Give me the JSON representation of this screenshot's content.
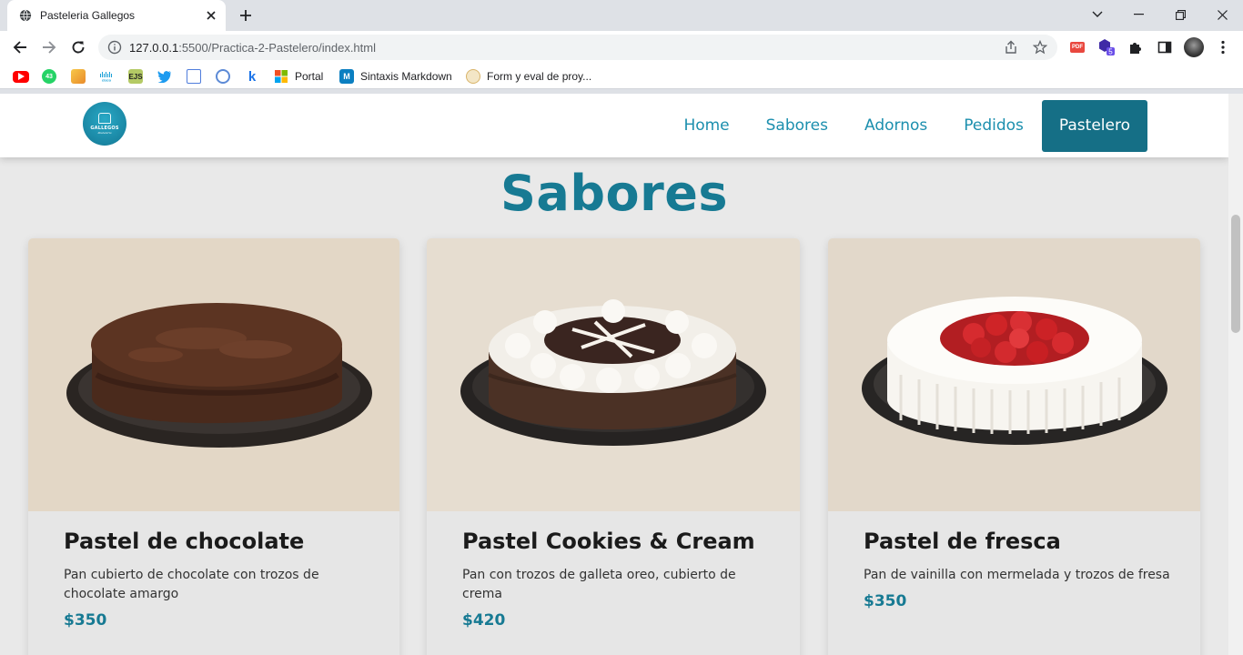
{
  "browser": {
    "tab_title": "Pasteleria Gallegos",
    "url_host": "127.0.0.1",
    "url_path": ":5500/Practica-2-Pastelero/index.html",
    "bookmarks": [
      {
        "label": "",
        "icon": "youtube-icon",
        "color": "#ff0000"
      },
      {
        "label": "",
        "icon": "whatsapp-icon",
        "color": "#25d366",
        "badge": "43"
      },
      {
        "label": "",
        "icon": "notes-icon",
        "color": "#f4a623"
      },
      {
        "label": "",
        "icon": "cisco-icon",
        "color": "#1ba0d7"
      },
      {
        "label": "",
        "icon": "ejs-icon",
        "color": "#b4ca65"
      },
      {
        "label": "",
        "icon": "twitter-icon",
        "color": "#1d9bf0"
      },
      {
        "label": "",
        "icon": "calendar-icon",
        "color": "#4f7ddc"
      },
      {
        "label": "",
        "icon": "target-icon",
        "color": "#5c8ad6"
      },
      {
        "label": "",
        "icon": "k-icon",
        "color": "#1a73e8"
      },
      {
        "label": "Portal",
        "icon": "microsoft-icon",
        "color": "#f25022"
      },
      {
        "label": "Sintaxis Markdown",
        "icon": "markdown-icon",
        "color": "#0b7fc1"
      },
      {
        "label": "Form y eval de proy...",
        "icon": "seal-icon",
        "color": "#d9b46a"
      }
    ],
    "extension_badge": "5"
  },
  "site": {
    "nav": {
      "home": "Home",
      "sabores": "Sabores",
      "adornos": "Adornos",
      "pedidos": "Pedidos",
      "pastelero": "Pastelero"
    },
    "logo_text": "GALLEGOS",
    "logo_sub": "Pasteleria",
    "section_title": "Sabores",
    "cards": [
      {
        "title": "Pastel de chocolate",
        "description": "Pan cubierto de chocolate con trozos de chocolate amargo",
        "price": "$350",
        "image": "chocolate-cake-image"
      },
      {
        "title": "Pastel Cookies & Cream",
        "description": "Pan con trozos de galleta oreo, cubierto de crema",
        "price": "$420",
        "image": "cookies-cream-cake-image"
      },
      {
        "title": "Pastel de fresca",
        "description": "Pan de vainilla con mermelada y trozos de fresa",
        "price": "$350",
        "image": "strawberry-cake-image"
      }
    ]
  },
  "colors": {
    "accent": "#177a93",
    "nav_link": "#1c8fae",
    "nav_active_bg": "#156f86",
    "page_bg": "#e9e9e9"
  }
}
